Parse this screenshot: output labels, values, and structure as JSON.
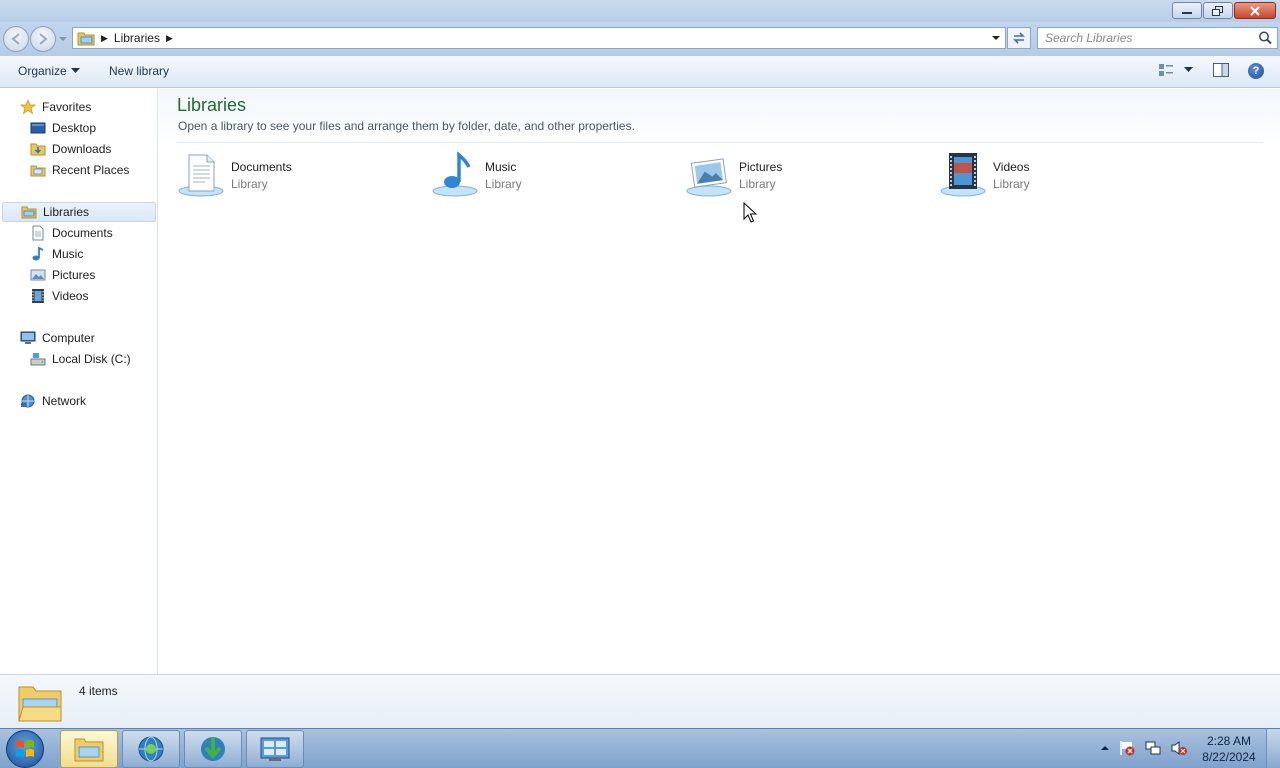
{
  "window": {
    "minimize_icon": "minimize-icon",
    "maximize_icon": "restore-icon",
    "close_icon": "close-icon"
  },
  "address": {
    "crumb": "Libraries",
    "search_placeholder": "Search Libraries"
  },
  "toolbar": {
    "organize_label": "Organize",
    "new_library_label": "New library"
  },
  "nav": {
    "favorites": {
      "label": "Favorites",
      "items": [
        {
          "label": "Desktop"
        },
        {
          "label": "Downloads"
        },
        {
          "label": "Recent Places"
        }
      ]
    },
    "libraries": {
      "label": "Libraries",
      "items": [
        {
          "label": "Documents"
        },
        {
          "label": "Music"
        },
        {
          "label": "Pictures"
        },
        {
          "label": "Videos"
        }
      ]
    },
    "computer": {
      "label": "Computer",
      "items": [
        {
          "label": "Local Disk (C:)"
        }
      ]
    },
    "network": {
      "label": "Network"
    }
  },
  "content": {
    "title": "Libraries",
    "subtitle": "Open a library to see your files and arrange them by folder, date, and other properties.",
    "libraries": [
      {
        "name": "Documents",
        "type": "Library",
        "icon": "documents-library-icon"
      },
      {
        "name": "Music",
        "type": "Library",
        "icon": "music-library-icon"
      },
      {
        "name": "Pictures",
        "type": "Library",
        "icon": "pictures-library-icon"
      },
      {
        "name": "Videos",
        "type": "Library",
        "icon": "videos-library-icon"
      }
    ]
  },
  "details": {
    "item_count": "4 items"
  },
  "taskbar": {
    "time": "2:28 AM",
    "date": "8/22/2024"
  }
}
